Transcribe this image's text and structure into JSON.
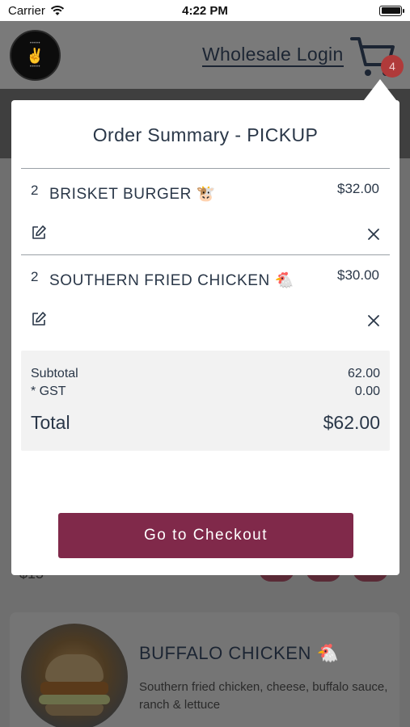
{
  "status_bar": {
    "carrier": "Carrier",
    "time": "4:22 PM"
  },
  "header": {
    "wholesale_label": "Wholesale Login",
    "cart_count": "4",
    "logo_icon": "restaurant-logo-icon"
  },
  "order_summary": {
    "title": "Order Summary - PICKUP",
    "items": [
      {
        "qty": "2",
        "name": "BRISKET BURGER 🐮",
        "price": "$32.00"
      },
      {
        "qty": "2",
        "name": "SOUTHERN FRIED CHICKEN 🐔",
        "price": "$30.00"
      }
    ],
    "subtotal_label": "Subtotal",
    "subtotal_value": "62.00",
    "gst_label": "* GST",
    "gst_value": "0.00",
    "total_label": "Total",
    "total_value": "$62.00",
    "checkout_label": "Go to Checkout"
  },
  "background": {
    "price_fragment": "$15",
    "card": {
      "title": "BUFFALO CHICKEN 🐔",
      "description": "Southern fried chicken, cheese, buffalo sauce, ranch & lettuce"
    }
  },
  "colors": {
    "accent": "#80294a",
    "badge": "#b03a3a",
    "text": "#2a3748"
  }
}
